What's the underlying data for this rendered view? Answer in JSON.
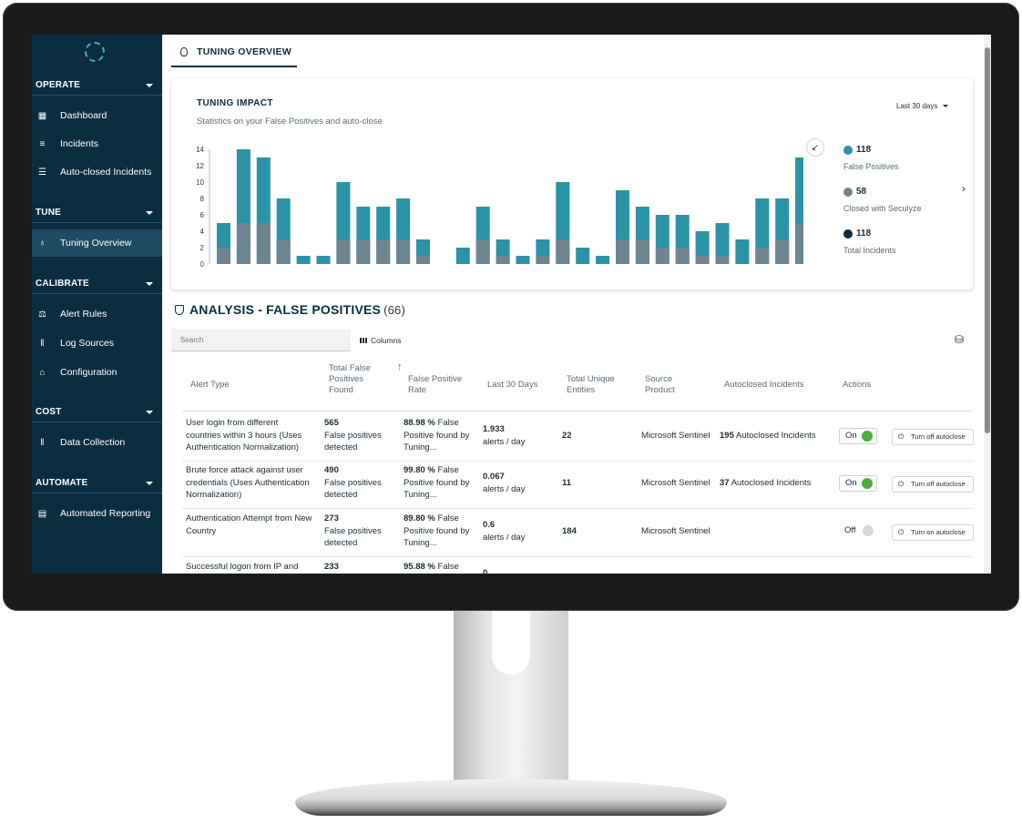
{
  "sidebar": {
    "sections": [
      {
        "label": "OPERATE",
        "items": [
          {
            "label": "Dashboard",
            "icon": "dashboard-icon"
          },
          {
            "label": "Incidents",
            "icon": "list-icon"
          },
          {
            "label": "Auto-closed Incidents",
            "icon": "checklist-icon"
          }
        ]
      },
      {
        "label": "TUNE",
        "items": [
          {
            "label": "Tuning Overview",
            "icon": "lightbulb-icon",
            "active": true
          }
        ]
      },
      {
        "label": "CALIBRATE",
        "items": [
          {
            "label": "Alert Rules",
            "icon": "scale-icon"
          },
          {
            "label": "Log Sources",
            "icon": "log-icon"
          },
          {
            "label": "Configuration",
            "icon": "bank-icon"
          }
        ]
      },
      {
        "label": "COST",
        "items": [
          {
            "label": "Data Collection",
            "icon": "data-icon"
          }
        ]
      },
      {
        "label": "AUTOMATE",
        "items": [
          {
            "label": "Automated Reporting",
            "icon": "document-icon"
          }
        ]
      }
    ]
  },
  "tab": {
    "label": "TUNING OVERVIEW"
  },
  "impact": {
    "title": "TUNING IMPACT",
    "subtitle": "Statistics on your False Positives and auto-close",
    "range": "Last 30 days"
  },
  "legend": [
    {
      "value": "118",
      "label": "False Positives",
      "color": "#2a93a6"
    },
    {
      "value": "58",
      "label": "Closed with Seculyze",
      "color": "#6d8591"
    },
    {
      "value": "118",
      "label": "Total Incidents",
      "color": "#0b2d40"
    }
  ],
  "chart_data": {
    "type": "bar",
    "ylim": [
      0,
      14
    ],
    "yticks": [
      0,
      2,
      4,
      6,
      8,
      10,
      12,
      14
    ],
    "series": [
      {
        "name": "False Positives",
        "values": [
          5,
          14,
          13,
          8,
          1,
          1,
          10,
          7,
          7,
          8,
          3,
          0,
          2,
          7,
          3,
          1,
          3,
          10,
          2,
          1,
          9,
          7,
          6,
          6,
          4,
          5,
          3,
          8,
          8,
          13
        ]
      },
      {
        "name": "Closed with Seculyze",
        "values": [
          2,
          5,
          5,
          3,
          0,
          0,
          3,
          3,
          3,
          3,
          1,
          0,
          0,
          3,
          1,
          0,
          1,
          3,
          0,
          0,
          3,
          3,
          2,
          2,
          1,
          1,
          0,
          2,
          3,
          5
        ]
      }
    ],
    "colors": {
      "false_positives": "#2a93a6",
      "closed": "#6d8591"
    }
  },
  "analysis": {
    "title": "ANALYSIS - FALSE POSITIVES",
    "count": "(66)",
    "search_placeholder": "Search",
    "columns_label": "Columns"
  },
  "table": {
    "headers": [
      "Alert Type",
      "Total False Positives Found",
      "False Positive Rate",
      "Last 30 Days",
      "Total Unique Entities",
      "Source Product",
      "Autoclosed Incidents",
      "Actions"
    ],
    "rows": [
      {
        "alert": "User login from different countries within 3 hours (Uses Authentication Normalization)",
        "total": "565",
        "total_sub": "False positives detected",
        "rate": "88.98 %",
        "rate_sub": "False Positive found by Tuning...",
        "last": "1.933",
        "last_sub": "alerts / day",
        "entities": "22",
        "source": "Microsoft Sentinel",
        "autoclosed_num": "195",
        "autoclosed_label": "Autoclosed Incidents",
        "toggle": "On",
        "action": "Turn off autoclose"
      },
      {
        "alert": "Brute force attack against user credentials (Uses Authentication Normalization)",
        "total": "490",
        "total_sub": "False positives detected",
        "rate": "99.80 %",
        "rate_sub": "False Positive found by Tuning...",
        "last": "0.067",
        "last_sub": "alerts / day",
        "entities": "11",
        "source": "Microsoft Sentinel",
        "autoclosed_num": "37",
        "autoclosed_label": "Autoclosed Incidents",
        "toggle": "On",
        "action": "Turn off autoclose"
      },
      {
        "alert": "Authentication Attempt from New Country",
        "total": "273",
        "total_sub": "False positives detected",
        "rate": "89.80 %",
        "rate_sub": "False Positive found by Tuning...",
        "last": "0.6",
        "last_sub": "alerts / day",
        "entities": "184",
        "source": "Microsoft Sentinel",
        "autoclosed_num": "",
        "autoclosed_label": "",
        "toggle": "Off",
        "action": "Turn on autoclose"
      },
      {
        "alert": "Successful logon from IP and",
        "total": "233",
        "total_sub": "",
        "rate": "95.88 %",
        "rate_sub": "False",
        "last": "0",
        "last_sub": "",
        "entities": "",
        "source": "",
        "autoclosed_num": "",
        "autoclosed_label": "",
        "toggle": "",
        "action": ""
      }
    ]
  },
  "colors": {
    "sidebar_bg": "#0b2d40",
    "toggle_on": "#4caf3a",
    "toggle_off": "#d9d9d9"
  }
}
